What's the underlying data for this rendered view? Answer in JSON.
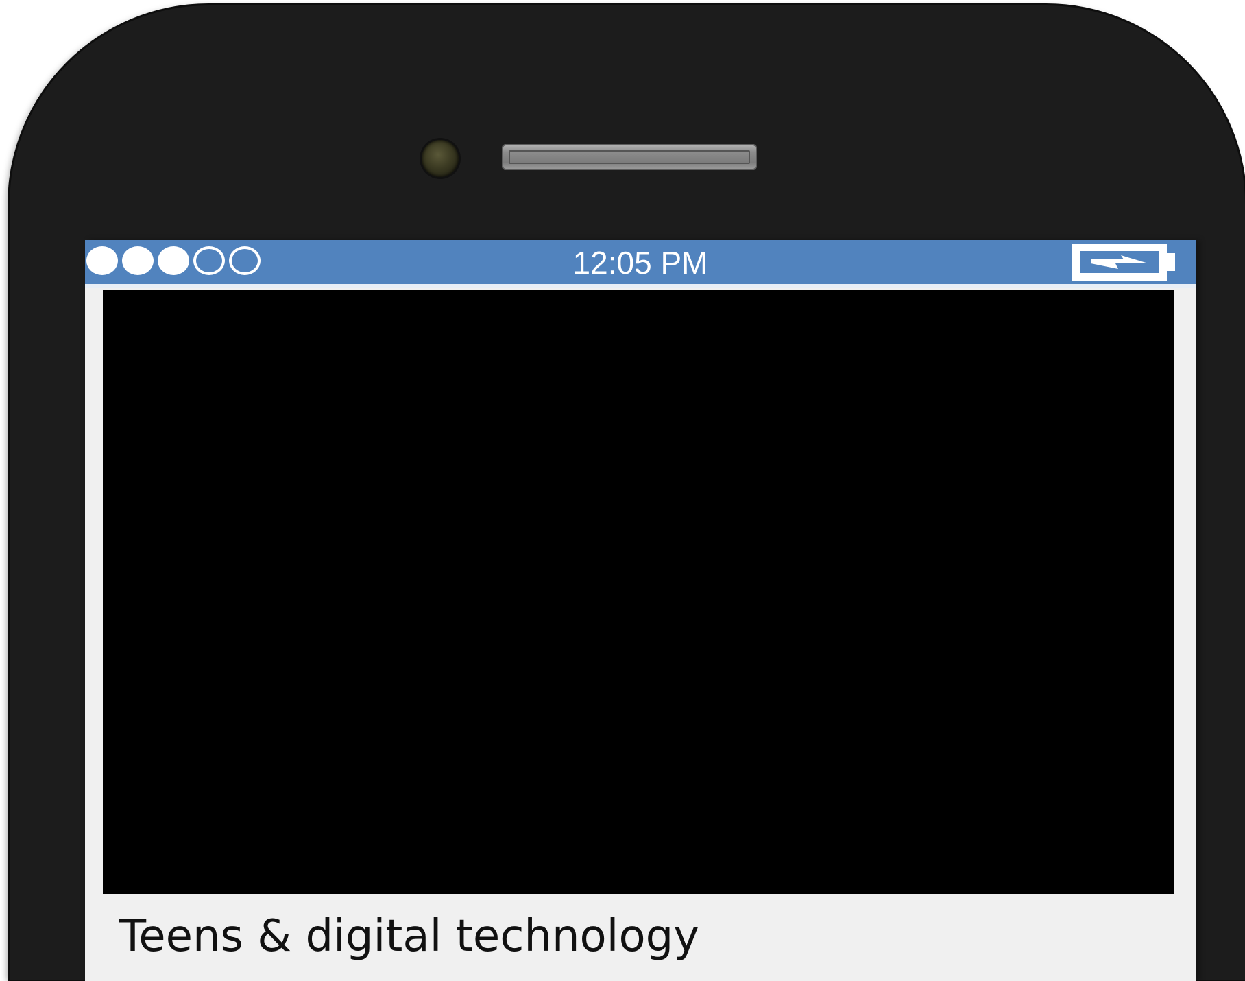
{
  "status_bar": {
    "time": "12:05 PM",
    "signal_bars_filled": 3,
    "signal_bars_total": 5,
    "battery_state": "charging",
    "color": "#5183be"
  },
  "video": {
    "state": "blank-black"
  },
  "caption": {
    "title": "Teens & digital technology"
  },
  "icons": {
    "camera": "front-camera-icon",
    "speaker": "earpiece-speaker-icon",
    "battery": "battery-charging-icon"
  }
}
